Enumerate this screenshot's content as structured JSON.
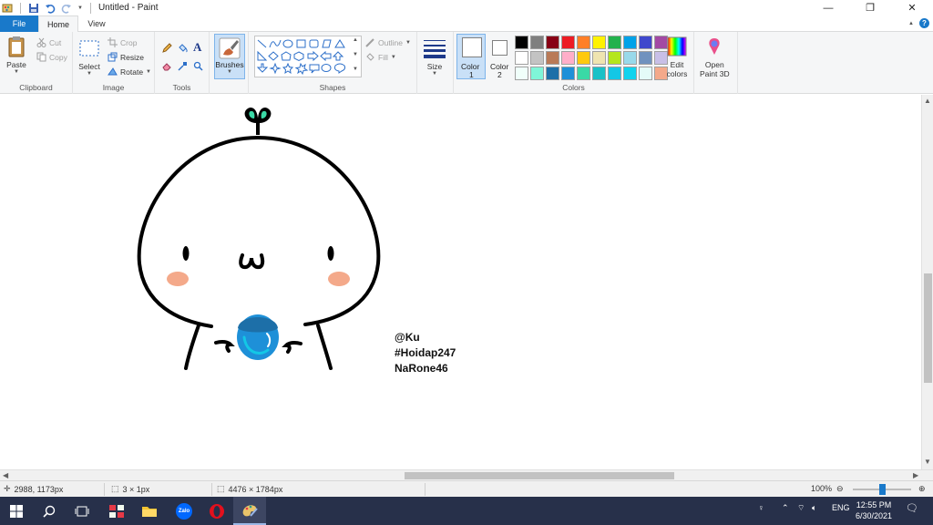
{
  "window": {
    "title": "Untitled - Paint",
    "minimize_glyph": "—",
    "restore_glyph": "❐",
    "close_glyph": "✕"
  },
  "tabs": {
    "file": "File",
    "home": "Home",
    "view": "View"
  },
  "ribbon": {
    "clipboard": {
      "label": "Clipboard",
      "paste": "Paste",
      "cut": "Cut",
      "copy": "Copy"
    },
    "image": {
      "label": "Image",
      "select": "Select",
      "crop": "Crop",
      "resize": "Resize",
      "rotate": "Rotate"
    },
    "tools": {
      "label": "Tools"
    },
    "brushes": {
      "label": "Brushes"
    },
    "shapes": {
      "label": "Shapes",
      "outline": "Outline",
      "fill": "Fill"
    },
    "size": {
      "label": "Size"
    },
    "colors": {
      "label": "Colors",
      "color1_label": "Color",
      "color1_num": "1",
      "color2_label": "Color",
      "color2_num": "2",
      "edit_label_1": "Edit",
      "edit_label_2": "colors",
      "color1_value": "#ffffff",
      "color2_value": "#ffffff",
      "palette": [
        "#000000",
        "#7f7f7f",
        "#880015",
        "#ed1c24",
        "#ff7f27",
        "#fff200",
        "#22b14c",
        "#00a2e8",
        "#3f48cc",
        "#a349a4",
        "#ffffff",
        "#c3c3c3",
        "#b97a57",
        "#ffaec9",
        "#ffc90e",
        "#efe4b0",
        "#b5e61d",
        "#99d9ea",
        "#7092be",
        "#c8bfe7",
        "#f0fffa",
        "#7ff5d8",
        "#1d6fa8",
        "#1e90d8",
        "#3ad9a6",
        "#1ac1c7",
        "#13c7e6",
        "#12d3ee",
        "#e4fbf8",
        "#f4a98a"
      ]
    },
    "paint3d": {
      "label_1": "Open",
      "label_2": "Paint 3D"
    }
  },
  "canvas": {
    "credits": [
      "@Ku",
      "#Hoidap247",
      "NaRone46"
    ],
    "colors": {
      "outline": "#000000",
      "sprout": "#3ad9a6",
      "blush": "#f4a98a",
      "orb_dark": "#1d6fa8",
      "orb_light": "#1e90d8",
      "orb_highlight": "#13c7e6"
    }
  },
  "status": {
    "cursor_pos": "2988, 1173px",
    "selection_size": "3 × 1px",
    "canvas_size": "4476 × 1784px",
    "zoom": "100%"
  },
  "taskbar": {
    "input_lang": "ENG",
    "time": "12:55 PM",
    "date": "6/30/2021",
    "zalo_label": "Zalo"
  }
}
